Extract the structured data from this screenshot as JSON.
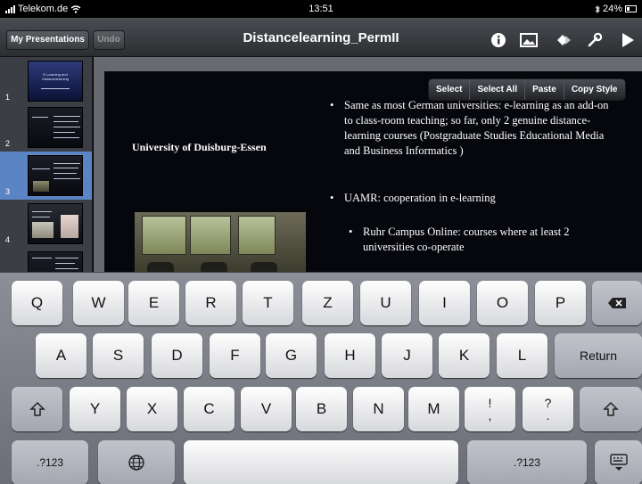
{
  "status_bar": {
    "carrier": "Telekom.de",
    "time": "13:51",
    "battery": "24%"
  },
  "toolbar": {
    "my_presentations": "My Presentations",
    "undo": "Undo",
    "title": "Distancelearning_PermII",
    "icons": [
      "info-icon",
      "image-icon",
      "shapes-icon",
      "wrench-icon",
      "play-icon"
    ]
  },
  "sidebar": {
    "selected": 3,
    "thumbnails": [
      {
        "number": "1"
      },
      {
        "number": "2"
      },
      {
        "number": "3"
      },
      {
        "number": "4"
      }
    ]
  },
  "slide": {
    "heading": "University of Duisburg-Essen",
    "bullets": [
      "Same as most German universities: e-learning as an add-on to class-room teaching; so far, only 2 genuine distance-learning courses (Postgraduate Studies Educational Media and Business Informatics )",
      "UAMR: cooperation in e-learning",
      "Ruhr Campus Online: courses where at least 2 universities co-operate"
    ]
  },
  "context_menu": {
    "items": [
      "Select",
      "Select All",
      "Paste",
      "Copy Style"
    ]
  },
  "keyboard": {
    "row1": [
      "Q",
      "W",
      "E",
      "R",
      "T",
      "Z",
      "U",
      "I",
      "O",
      "P"
    ],
    "row2": [
      "A",
      "S",
      "D",
      "F",
      "G",
      "H",
      "J",
      "K",
      "L"
    ],
    "row3": [
      "Y",
      "X",
      "C",
      "V",
      "B",
      "N",
      "M"
    ],
    "return": "Return",
    "numbers_left": ".?123",
    "numbers_right": ".?123",
    "punct1": [
      "!",
      ","
    ],
    "punct2": [
      "?",
      "."
    ]
  }
}
